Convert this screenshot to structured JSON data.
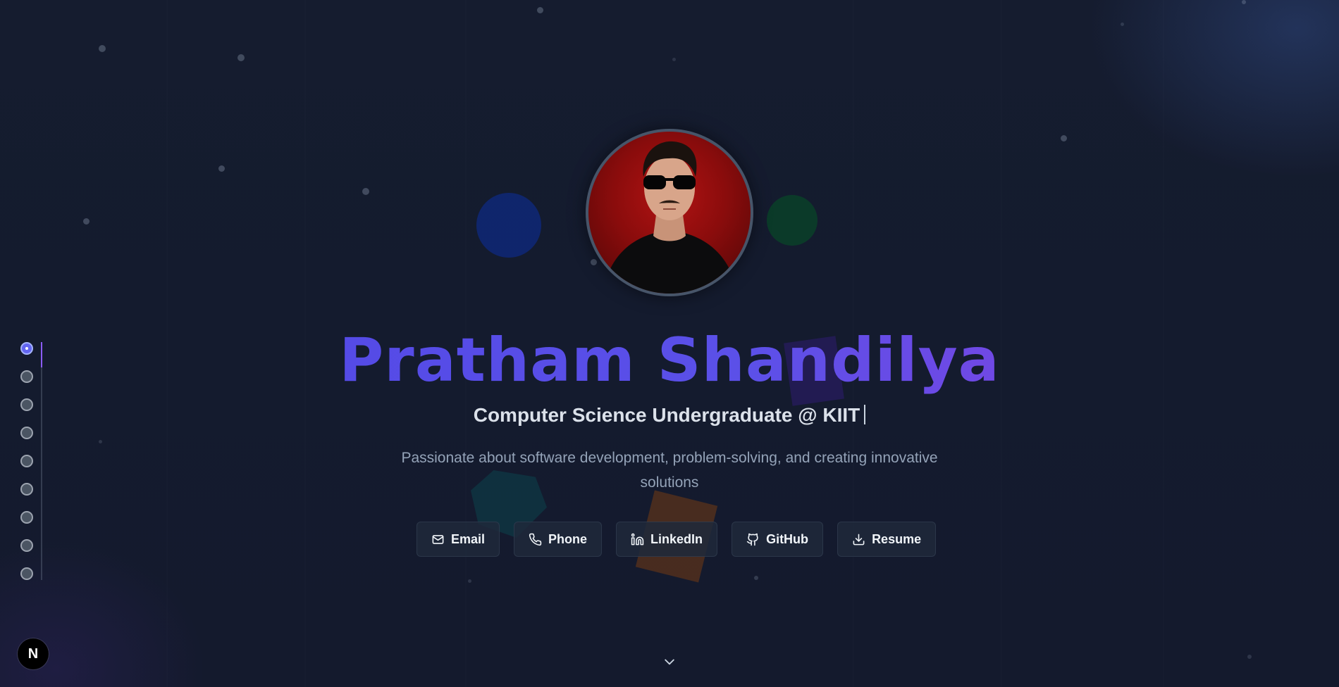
{
  "hero": {
    "name": "Pratham Shandilya",
    "subtitle": "Computer Science Undergraduate @ KIIT",
    "tagline": "Passionate about software development, problem-solving, and creating innovative solutions",
    "avatar_alt": "profile-photo"
  },
  "links": [
    {
      "label": "Email",
      "icon": "mail-icon"
    },
    {
      "label": "Phone",
      "icon": "phone-icon"
    },
    {
      "label": "LinkedIn",
      "icon": "linkedin-icon"
    },
    {
      "label": "GitHub",
      "icon": "github-icon"
    },
    {
      "label": "Resume",
      "icon": "download-icon"
    }
  ],
  "sidenav": {
    "count": 9,
    "active_index": 0
  },
  "badge": {
    "label": "N"
  },
  "colors": {
    "background": "#141c30",
    "accent_start": "#4f46e5",
    "accent_end": "#8b3fe0",
    "active_dot": "#6366f1"
  }
}
